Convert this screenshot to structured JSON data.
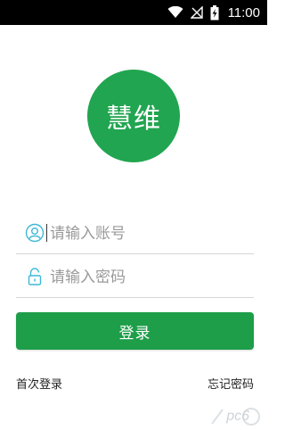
{
  "status_bar": {
    "time": "11:00",
    "icons": [
      "wifi-icon",
      "no-signal-icon",
      "battery-charging-icon"
    ]
  },
  "logo": {
    "text": "慧维",
    "color": "#21a550"
  },
  "form": {
    "username": {
      "placeholder": "请输入账号",
      "value": "",
      "icon": "user-icon"
    },
    "password": {
      "placeholder": "请输入密码",
      "value": "",
      "icon": "lock-icon"
    },
    "accent_color": "#3db8d6"
  },
  "login_button": {
    "label": "登录",
    "color": "#1e9e49"
  },
  "links": {
    "first_login": "首次登录",
    "forgot_password": "忘记密码"
  },
  "watermark": {
    "text": "pc6"
  }
}
